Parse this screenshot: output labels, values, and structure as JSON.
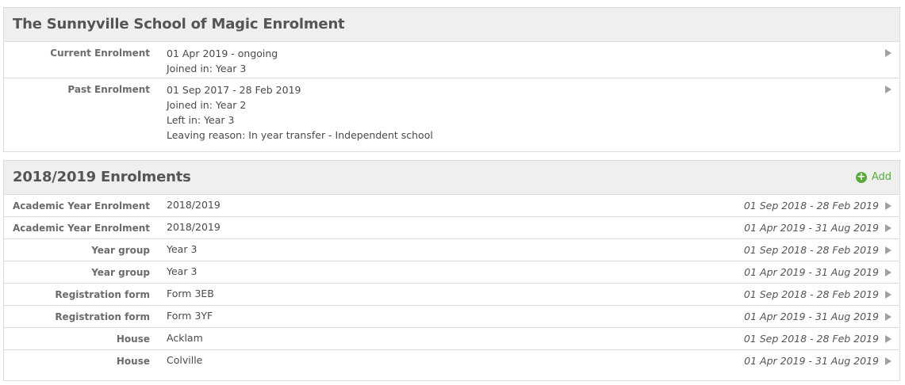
{
  "school_panel": {
    "title": "The Sunnyville School of Magic Enrolment",
    "rows": [
      {
        "label": "Current Enrolment",
        "lines": [
          "01 Apr 2019 - ongoing",
          "Joined in: Year 3"
        ]
      },
      {
        "label": "Past Enrolment",
        "lines": [
          "01 Sep 2017 - 28 Feb 2019",
          "Joined in: Year 2",
          "Left in: Year 3",
          "Leaving reason: In year transfer - Independent school"
        ]
      }
    ]
  },
  "year_panel": {
    "title": "2018/2019 Enrolments",
    "add_label": "Add",
    "rows": [
      {
        "label": "Academic Year Enrolment",
        "value": "2018/2019",
        "dates": "01 Sep 2018 - 28 Feb 2019"
      },
      {
        "label": "Academic Year Enrolment",
        "value": "2018/2019",
        "dates": "01 Apr 2019 - 31 Aug 2019"
      },
      {
        "label": "Year group",
        "value": "Year 3",
        "dates": "01 Sep 2018 - 28 Feb 2019"
      },
      {
        "label": "Year group",
        "value": "Year 3",
        "dates": "01 Apr 2019 - 31 Aug 2019"
      },
      {
        "label": "Registration form",
        "value": "Form 3EB",
        "dates": "01 Sep 2018 - 28 Feb 2019"
      },
      {
        "label": "Registration form",
        "value": "Form 3YF",
        "dates": "01 Apr 2019 - 31 Aug 2019"
      },
      {
        "label": "House",
        "value": "Acklam",
        "dates": "01 Sep 2018 - 28 Feb 2019"
      },
      {
        "label": "House",
        "value": "Colville",
        "dates": "01 Apr 2019 - 31 Aug 2019"
      }
    ]
  },
  "icons": {
    "add": "plus-circle-icon",
    "row_arrow": "triangle-right-icon"
  },
  "colors": {
    "accent_green": "#5aab3a",
    "header_bg": "#efefef",
    "border": "#dcdcdc"
  }
}
